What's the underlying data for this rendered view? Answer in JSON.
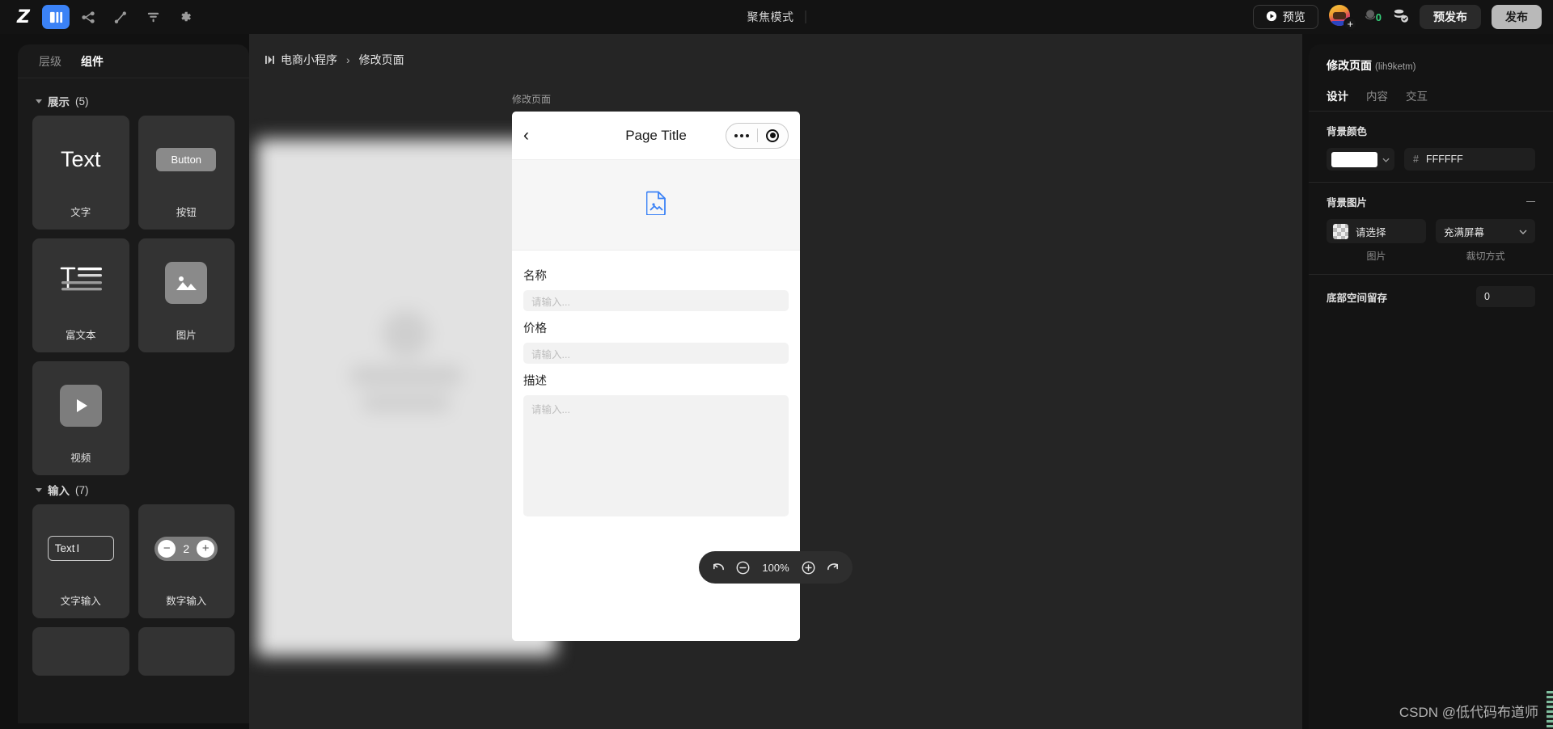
{
  "topbar": {
    "logo": "Z",
    "focus_mode_label": "聚焦模式",
    "preview_label": "预览",
    "coin_count": "0",
    "prepublish_label": "预发布",
    "publish_label": "发布",
    "icons": [
      "logo-z",
      "pages-panel-icon",
      "flow-icon",
      "plugin-icon",
      "align-icon",
      "settings-gear-icon"
    ]
  },
  "left_panel": {
    "tabs": [
      {
        "label": "层级",
        "active": false
      },
      {
        "label": "组件",
        "active": true
      }
    ],
    "groups": [
      {
        "title": "展示",
        "count": "(5)",
        "items": [
          {
            "label": "文字",
            "visual": "Text"
          },
          {
            "label": "按钮",
            "visual": "Button"
          },
          {
            "label": "富文本",
            "visual": "richtext-icon"
          },
          {
            "label": "图片",
            "visual": "image-icon"
          },
          {
            "label": "视频",
            "visual": "video-icon"
          }
        ]
      },
      {
        "title": "输入",
        "count": "(7)",
        "items": [
          {
            "label": "文字输入",
            "visual": "Text"
          },
          {
            "label": "数字输入",
            "visual": "2"
          }
        ]
      }
    ]
  },
  "canvas": {
    "breadcrumb": {
      "icons": "❮❯",
      "root": "电商小程序",
      "separator": "›",
      "current": "修改页面"
    },
    "focus_caption": "修改页面",
    "zoom": {
      "undo": "undo-icon",
      "minus": "−",
      "value": "100%",
      "plus": "+",
      "redo": "redo-icon"
    }
  },
  "phone": {
    "nav": {
      "back": "‹",
      "title": "Page Title"
    },
    "image_placeholder": "image-file-icon",
    "fields": [
      {
        "label": "名称",
        "type": "input",
        "placeholder": "请输入..."
      },
      {
        "label": "价格",
        "type": "input",
        "placeholder": "请输入..."
      },
      {
        "label": "描述",
        "type": "textarea",
        "placeholder": "请输入..."
      }
    ]
  },
  "right_panel": {
    "title": "修改页面",
    "title_id": "(lih9ketm)",
    "tabs": [
      {
        "label": "设计",
        "active": true
      },
      {
        "label": "内容",
        "active": false
      },
      {
        "label": "交互",
        "active": false
      }
    ],
    "bg_color": {
      "section_title": "背景颜色",
      "swatch_hex": "#FFFFFF",
      "hash": "#",
      "hex_value": "FFFFFF"
    },
    "bg_image": {
      "section_title": "背景图片",
      "picker_label": "请选择",
      "picker_caption": "图片",
      "crop_value": "充满屏幕",
      "crop_caption": "裁切方式"
    },
    "bottom_space": {
      "label": "底部空间留存",
      "value": "0"
    }
  },
  "watermark": "CSDN @低代码布道师"
}
